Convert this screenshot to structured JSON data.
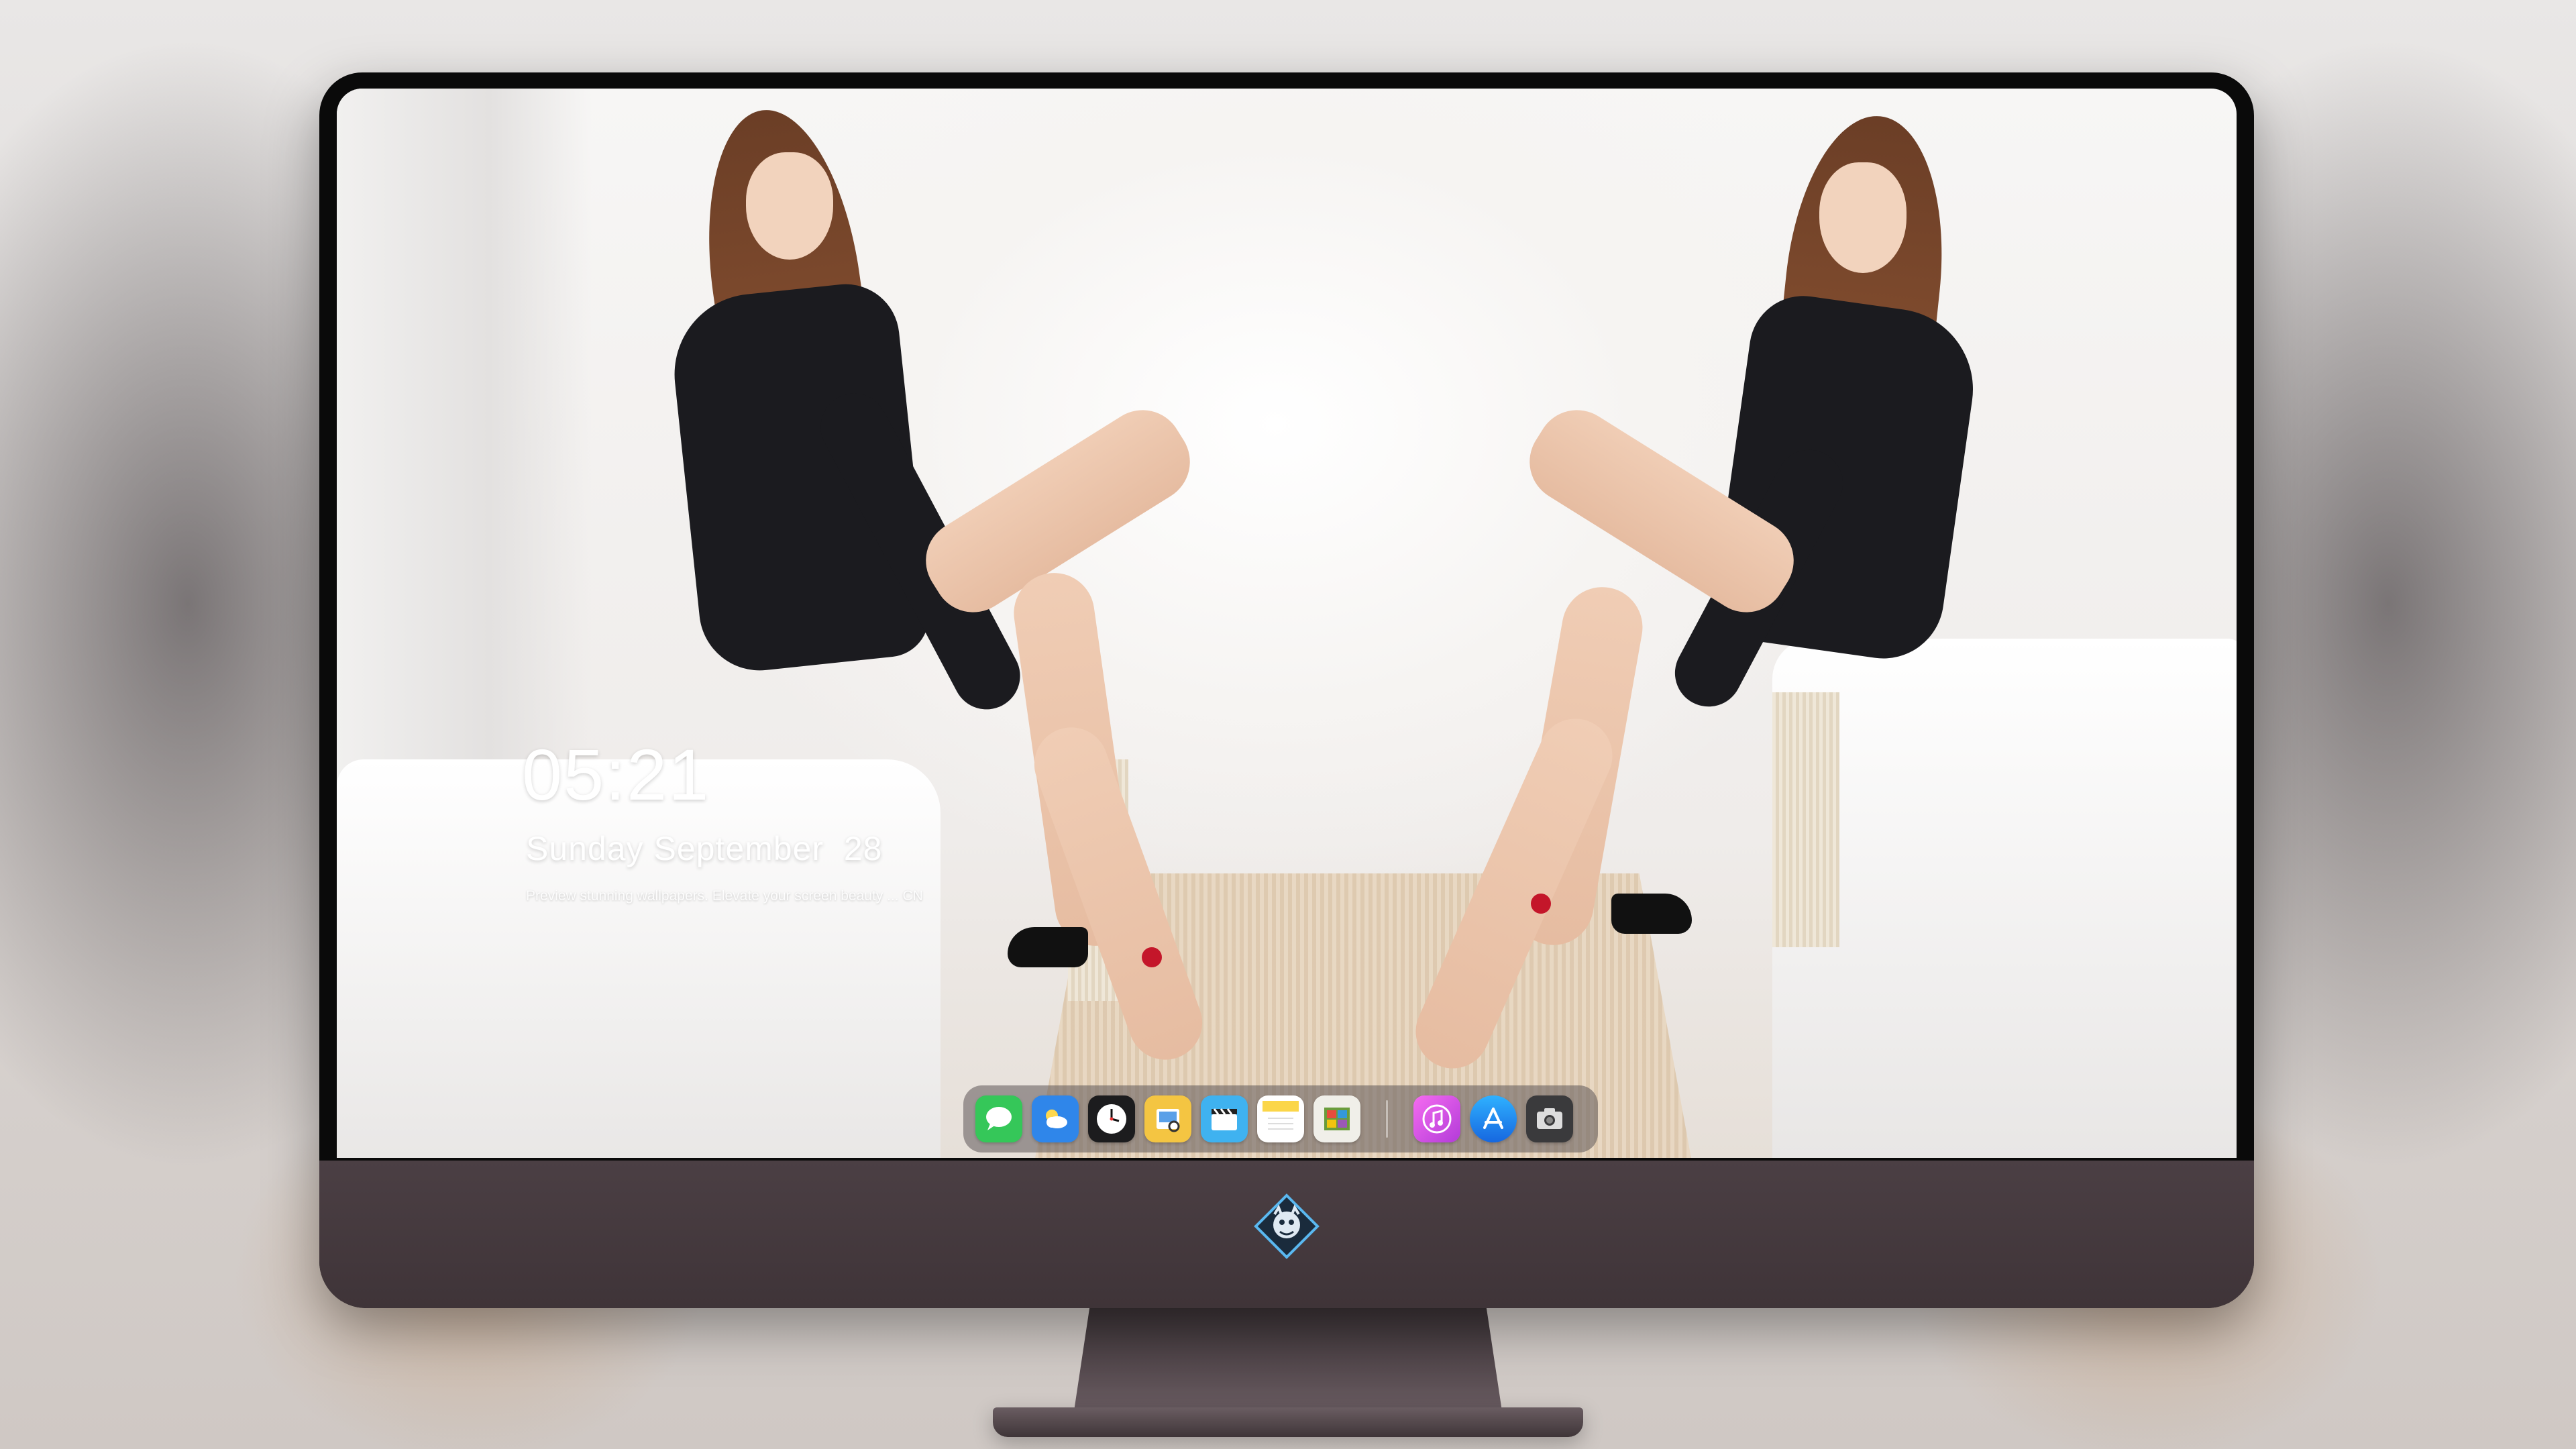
{
  "lock_screen": {
    "time": "05:21",
    "date": "Sunday September  28",
    "tagline": "Preview stunning wallpapers. Elevate your screen beauty ... CN"
  },
  "dock": {
    "apps": [
      {
        "name": "Messages",
        "icon": "messages-icon",
        "color": "#35c759"
      },
      {
        "name": "Weather",
        "icon": "weather-icon",
        "color": "#2f86ea"
      },
      {
        "name": "Clock",
        "icon": "clock-icon",
        "color": "#1c1c1e"
      },
      {
        "name": "Preview",
        "icon": "preview-icon",
        "color": "#f4c542"
      },
      {
        "name": "Clips",
        "icon": "clips-icon",
        "color": "#3fb2f0"
      },
      {
        "name": "Notes",
        "icon": "notes-icon",
        "color": "#fbd649"
      },
      {
        "name": "Photo Booth",
        "icon": "photos-icon",
        "color": "#6a9c3c"
      },
      {
        "name": "iTunes",
        "icon": "itunes-icon",
        "color": "#d54de0"
      },
      {
        "name": "App Store",
        "icon": "app-store-icon",
        "color": "#1d8ff0"
      },
      {
        "name": "Screenshot",
        "icon": "camera-icon",
        "color": "#3a3a3c"
      }
    ]
  },
  "colors": {
    "bezel": "#0a0a0a",
    "chin": "#453a3e",
    "text": "#ffffff"
  }
}
